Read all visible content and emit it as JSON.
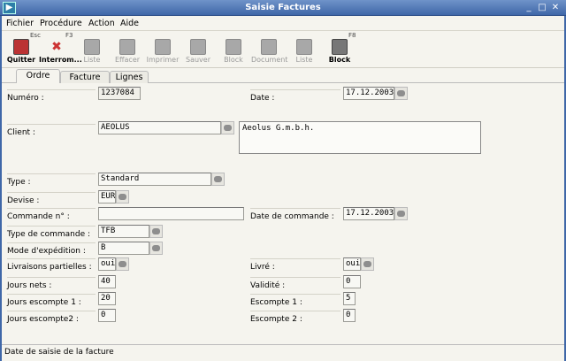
{
  "window": {
    "title": "Saisie Factures",
    "app_icon": "play-icon",
    "minimize": "_",
    "maximize": "□",
    "close": "✕"
  },
  "menu": [
    "Fichier",
    "Procédure",
    "Action",
    "Aide"
  ],
  "toolbar": {
    "buttons": [
      {
        "label": "Quitter",
        "icon": "exit-door-icon",
        "enabled": true,
        "key": "Esc"
      },
      {
        "label": "Interrom...",
        "icon": "cancel-x-icon",
        "enabled": true,
        "key": "F3"
      },
      {
        "label": "Liste",
        "icon": "list-icon",
        "enabled": false
      },
      {
        "label": "Effacer",
        "icon": "trash-icon",
        "enabled": false
      },
      {
        "label": "Imprimer",
        "icon": "printer-icon",
        "enabled": false
      },
      {
        "label": "Sauver",
        "icon": "floppy-save-icon",
        "enabled": false
      },
      {
        "label": "Block",
        "icon": "block-icon",
        "enabled": false
      },
      {
        "label": "Document",
        "icon": "magnifier-icon",
        "enabled": false
      },
      {
        "label": "Liste",
        "icon": "list-icon",
        "enabled": false
      },
      {
        "label": "Block",
        "icon": "block-icon",
        "enabled": true,
        "key": "F8"
      }
    ]
  },
  "tabs": [
    "Ordre",
    "Facture",
    "Lignes"
  ],
  "form": {
    "numero": {
      "label": "Numéro :",
      "value": "1237084"
    },
    "date": {
      "label": "Date :",
      "value": "17.12.2003"
    },
    "client": {
      "label": "Client :",
      "value": "AEOLUS",
      "name": "Aeolus G.m.b.h."
    },
    "type": {
      "label": "Type :",
      "value": "Standard"
    },
    "devise": {
      "label": "Devise :",
      "value": "EUR"
    },
    "commande": {
      "label": "Commande n° :",
      "value": ""
    },
    "date_commande": {
      "label": "Date de commande :",
      "value": "17.12.2003"
    },
    "type_commande": {
      "label": "Type de commande :",
      "value": "TFB"
    },
    "mode_expedition": {
      "label": "Mode d'expédition :",
      "value": "B"
    },
    "livraisons_partielles": {
      "label": "Livraisons partielles :",
      "value": "oui"
    },
    "livre": {
      "label": "Livré :",
      "value": "oui"
    },
    "jours_nets": {
      "label": "Jours nets :",
      "value": "40"
    },
    "validite": {
      "label": "Validité :",
      "value": "0"
    },
    "jours_escompte1": {
      "label": "Jours escompte 1 :",
      "value": "20"
    },
    "escompte1": {
      "label": "Escompte 1 :",
      "value": "5"
    },
    "jours_escompte2": {
      "label": "Jours escompte2 :",
      "value": "0"
    },
    "escompte2": {
      "label": "Escompte 2 :",
      "value": "0"
    }
  },
  "status": "Date de saisie de la facture"
}
